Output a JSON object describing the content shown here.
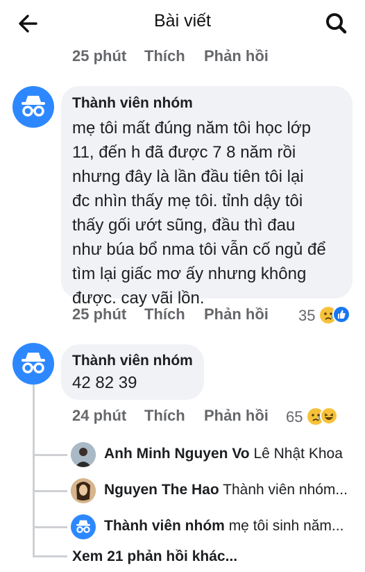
{
  "header": {
    "title": "Bài viết",
    "back_icon": "arrow-left-icon",
    "search_icon": "search-icon"
  },
  "top_actions": {
    "time": "25 phút",
    "like": "Thích",
    "reply": "Phản hồi"
  },
  "comments": [
    {
      "author": "Thành viên nhóm",
      "text_lines": [
        "mẹ tôi mất đúng năm tôi học lớp",
        "11, đến h đã được 7 8 năm rồi",
        "nhưng đây là lần đầu tiên tôi lại",
        "đc nhìn thấy mẹ tôi. tỉnh dậy tôi",
        "thấy gối ướt sũng, đầu thì đau",
        "như búa bổ nma tôi vẫn cố ngủ để",
        "tìm lại giấc mơ ấy nhưng không",
        "được. cay vãi lồn."
      ],
      "time": "25 phút",
      "like": "Thích",
      "reply": "Phản hồi",
      "reaction_count": "35",
      "reaction_icons": [
        "sad-reaction-icon",
        "like-reaction-icon"
      ]
    },
    {
      "author": "Thành viên nhóm",
      "text": "42 82 39",
      "time": "24 phút",
      "like": "Thích",
      "reply": "Phản hồi",
      "reaction_count": "65",
      "reaction_icons": [
        "sad-reaction-icon",
        "haha-reaction-icon"
      ]
    }
  ],
  "replies": [
    {
      "author": "Anh Minh Nguyen Vo",
      "text": "Lê Nhật Khoa"
    },
    {
      "author": "Nguyen The Hao",
      "text": "Thành viên nhóm..."
    },
    {
      "author": "Thành viên nhóm",
      "text": "mẹ tôi sinh năm..."
    }
  ],
  "more_replies": "Xem 21 phản hồi khác...",
  "colors": {
    "anon_avatar": "#2d88ff",
    "bubble": "#f0f2f5",
    "meta_text": "#65676b",
    "like_blue": "#1877f2",
    "sad_yellow": "#f7c23a"
  }
}
